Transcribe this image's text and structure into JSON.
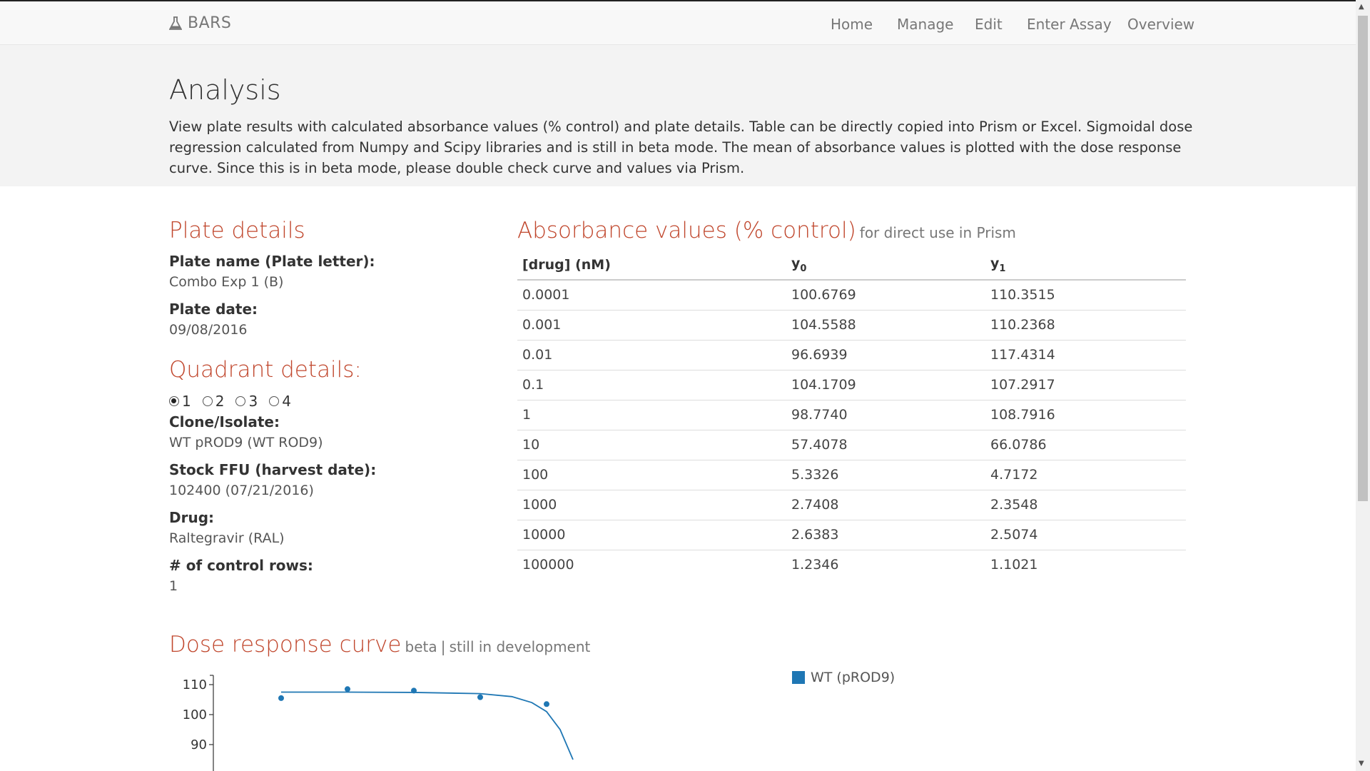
{
  "navbar": {
    "brand": "BARS",
    "links": [
      "Home",
      "Manage",
      "Edit",
      "Enter Assay",
      "Overview"
    ]
  },
  "jumbotron": {
    "title": "Analysis",
    "lead": "View plate results with calculated absorbance values (% control) and plate details. Table can be directly copied into Prism or Excel. Sigmoidal dose regression calculated from Numpy and Scipy libraries and is still in beta mode. The mean of absorbance values is plotted with the dose response curve. Since this is in beta mode, please double check curve and values via Prism."
  },
  "plate": {
    "heading": "Plate details",
    "name_label": "Plate name (Plate letter):",
    "name_value": "Combo Exp 1 (B)",
    "date_label": "Plate date:",
    "date_value": "09/08/2016"
  },
  "quadrant": {
    "heading": "Quadrant details:",
    "options": [
      "1",
      "2",
      "3",
      "4"
    ],
    "selected": "1",
    "clone_label": "Clone/Isolate:",
    "clone_value": "WT pROD9 (WT ROD9)",
    "stock_label": "Stock FFU (harvest date):",
    "stock_value": "102400 (07/21/2016)",
    "drug_label": "Drug:",
    "drug_value": "Raltegravir (RAL)",
    "control_label": "# of control rows:",
    "control_value": "1"
  },
  "absorbance": {
    "heading": "Absorbance values (% control)",
    "subheading": "for direct use in Prism",
    "columns": [
      "[drug] (nM)",
      "y",
      "y"
    ],
    "column_subs": [
      "",
      "0",
      "1"
    ],
    "rows": [
      [
        "0.0001",
        "100.6769",
        "110.3515"
      ],
      [
        "0.001",
        "104.5588",
        "110.2368"
      ],
      [
        "0.01",
        "96.6939",
        "117.4314"
      ],
      [
        "0.1",
        "104.1709",
        "107.2917"
      ],
      [
        "1",
        "98.7740",
        "108.7916"
      ],
      [
        "10",
        "57.4078",
        "66.0786"
      ],
      [
        "100",
        "5.3326",
        "4.7172"
      ],
      [
        "1000",
        "2.7408",
        "2.3548"
      ],
      [
        "10000",
        "2.6383",
        "2.5074"
      ],
      [
        "100000",
        "1.2346",
        "1.1021"
      ]
    ]
  },
  "dose": {
    "heading": "Dose response curve",
    "beta": "beta",
    "sep": "|",
    "note": "still in development"
  },
  "chart_data": {
    "type": "scatter",
    "title": "",
    "xlabel": "",
    "ylabel": "",
    "x_scale": "log",
    "x": [
      0.0001,
      0.001,
      0.01,
      0.1,
      1
    ],
    "series": [
      {
        "name": "WT (pROD9)",
        "values": [
          105.5,
          108.5,
          108.0,
          105.8,
          103.5
        ],
        "color": "#1f77b4"
      }
    ],
    "curve": {
      "x": [
        0.0001,
        0.001,
        0.01,
        0.1,
        0.3,
        0.6,
        1,
        1.6,
        2.5
      ],
      "y": [
        107.5,
        107.5,
        107.4,
        107.0,
        106.0,
        104.0,
        101.0,
        95.0,
        85.0
      ]
    },
    "y_ticks": [
      110,
      100,
      90
    ],
    "ylim": [
      85,
      113
    ],
    "legend_position": "top-right"
  },
  "colors": {
    "accent": "#c0462c",
    "series": "#1f77b4"
  }
}
